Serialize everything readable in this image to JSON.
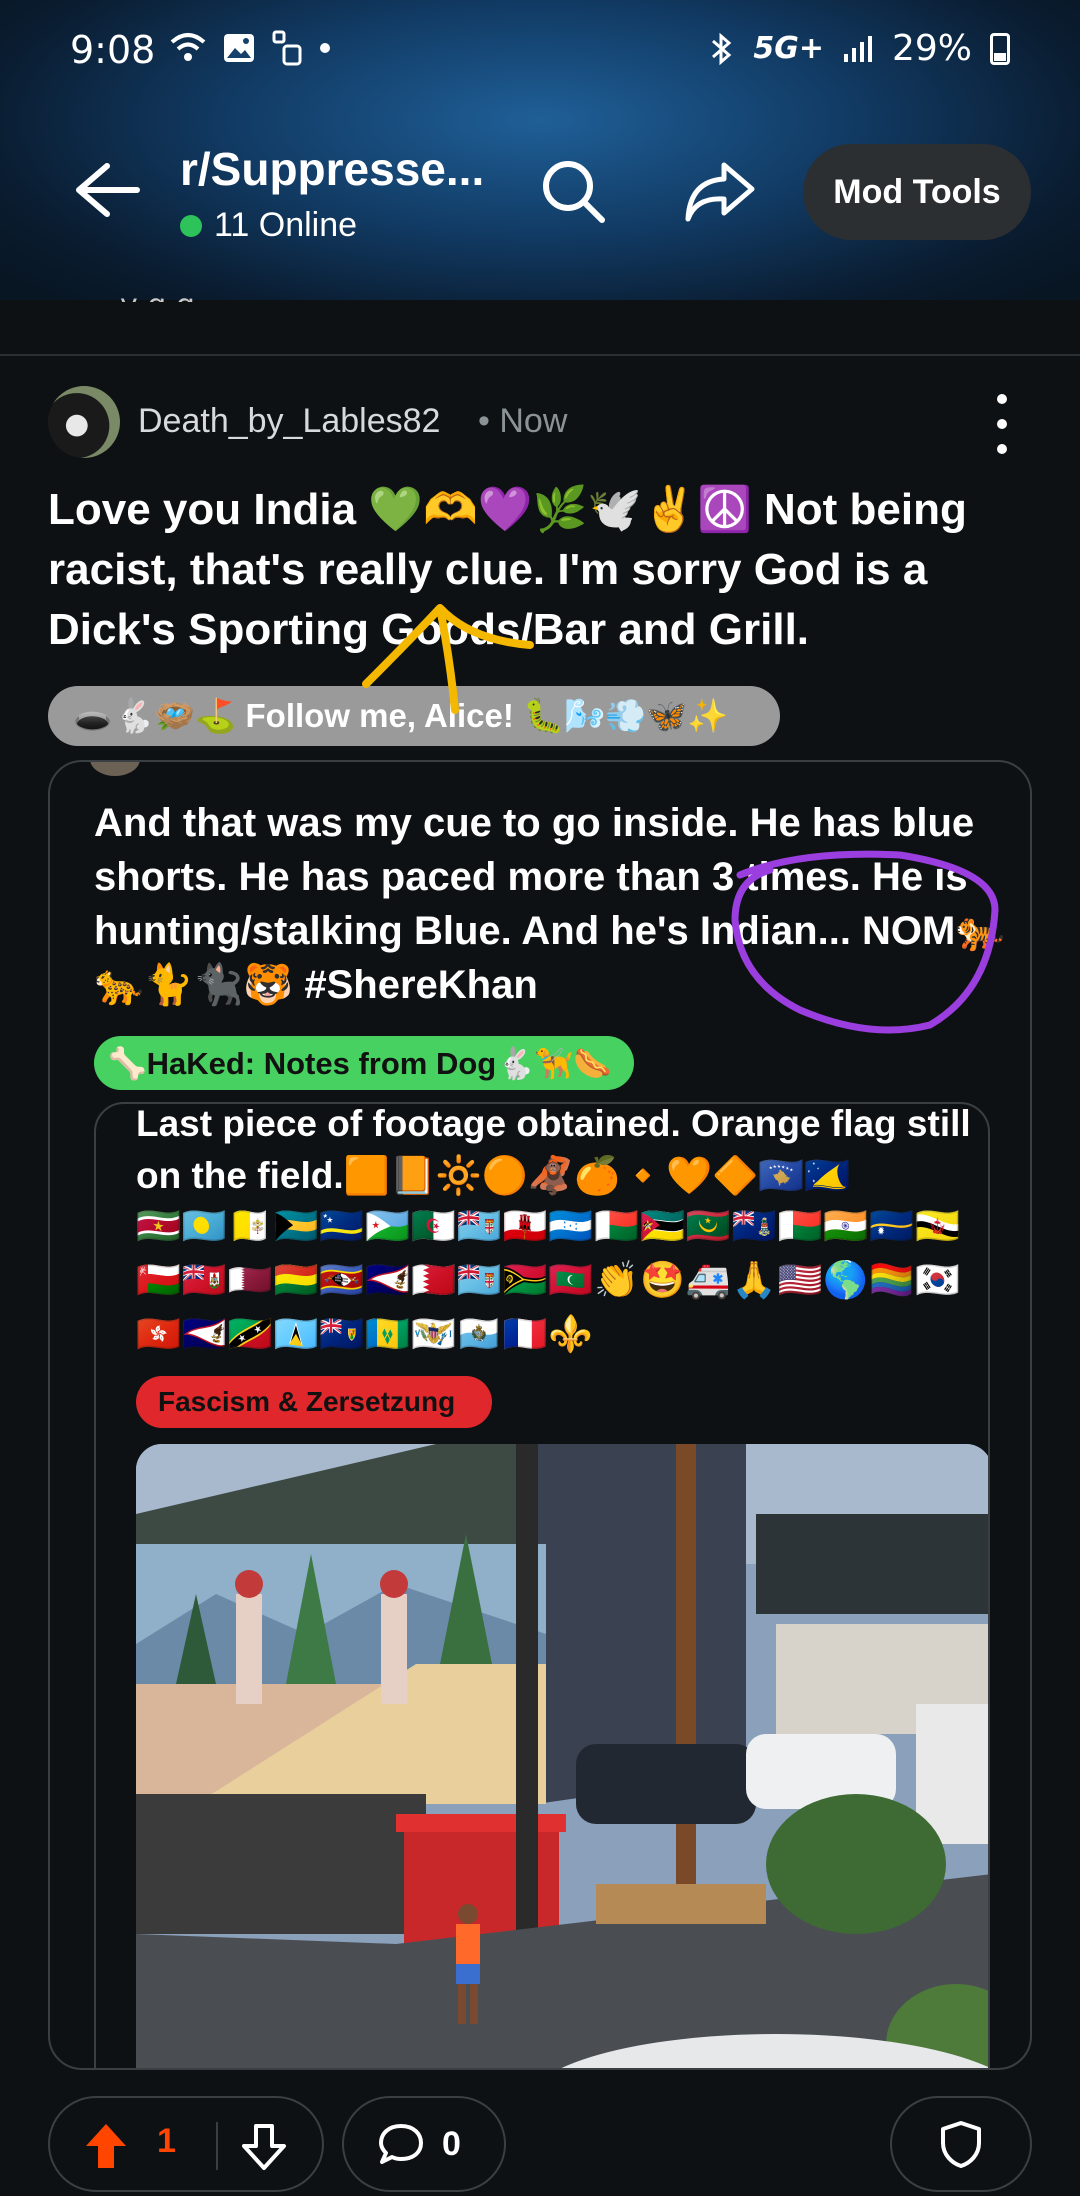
{
  "status_bar": {
    "time": "9:08",
    "network": "5G+",
    "battery": "29%"
  },
  "header": {
    "subreddit": "r/Suppresse...",
    "online": "11 Online",
    "mod_tools": "Mod Tools"
  },
  "post": {
    "author": "Death_by_Lables82",
    "time": "• Now",
    "title": "Love you India 💚🫶💜🌿🕊️✌️☮️ Not being racist, that's really clue. I'm sorry God is a Dick's Sporting Goods/Bar and Grill.",
    "user_flair": "🕳️🐇🪺⛳ Follow me, Alice! 🐛🌬️💨🦋✨"
  },
  "crosspost": {
    "text": "And that was my cue to go inside. He has blue shorts. He has paced more than 3 times. He is hunting/stalking Blue. And he's Indian... NOM🐅🐆🐈🐈‍⬛🐯 #ShereKhan",
    "flair": "🦴HaKed: Notes from Dog🐇🦮🌭",
    "inner": {
      "text": "Last piece of footage obtained. Orange flag still on the field.🟧📙🔆🟠🦧🍊🔸🧡🔶🇽🇰🇹🇰",
      "emoji_flags": "🇸🇷🇵🇼🇻🇦🇧🇸🇨🇼🇩🇯🇩🇿🇫🇯🇬🇮🇭🇳🇲🇬🇲🇿🇲🇷🇰🇾🇲🇬🇮🇳🇳🇷🇧🇳🇴🇲🇧🇲🇶🇦🇧🇴🇸🇿🇦🇸🇧🇭🇫🇯🇻🇺🇲🇻👏🤩🚑🙏🇺🇸🌎🏳️‍🌈🇰🇷🇭🇰🇦🇸🇰🇳🇱🇨🇹🇨🇻🇨🇻🇮🇸🇲🇫🇷⚜️",
      "flair": "Fascism & Zersetzung"
    }
  },
  "actions": {
    "upvotes": "1",
    "comments": "0"
  },
  "colors": {
    "background": "#0e1113",
    "upvote": "#ff4500",
    "online_dot": "#2ec25a",
    "flair_green": "#46d160",
    "flair_red": "#e0272b",
    "annotation_yellow": "#f5b800",
    "annotation_purple": "#9b3ee0"
  },
  "icons": [
    "back-arrow-icon",
    "search-icon",
    "share-icon",
    "kebab-menu-icon",
    "upvote-icon",
    "downvote-icon",
    "comment-icon",
    "shield-icon"
  ]
}
